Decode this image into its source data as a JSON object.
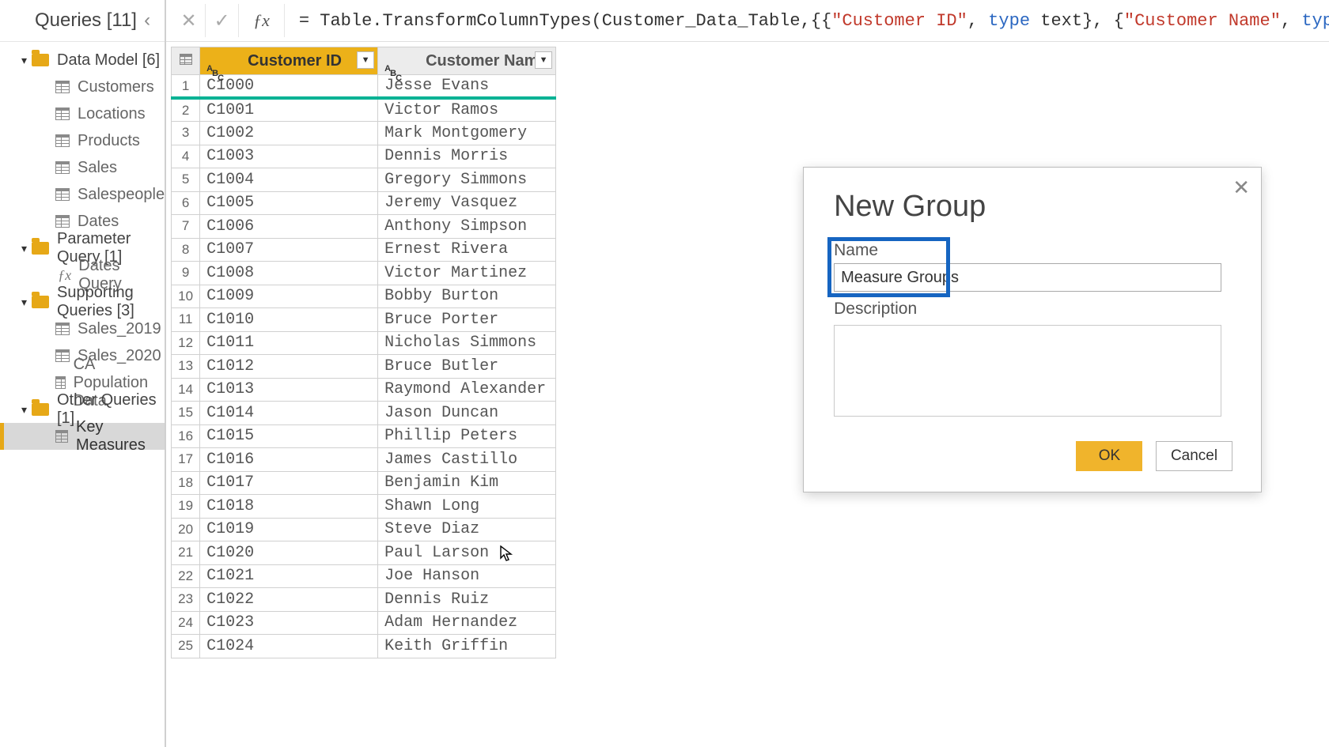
{
  "sidebar": {
    "title": "Queries [11]",
    "groups": [
      {
        "label": "Data Model [6]",
        "items": [
          "Customers",
          "Locations",
          "Products",
          "Sales",
          "Salespeople",
          "Dates"
        ],
        "icon": "table"
      },
      {
        "label": "Parameter Query [1]",
        "items": [
          "Dates Query"
        ],
        "icon": "fx"
      },
      {
        "label": "Supporting Queries [3]",
        "items": [
          "Sales_2019",
          "Sales_2020",
          "CA Population Data"
        ],
        "icon": "table"
      },
      {
        "label": "Other Queries [1]",
        "items": [
          "Key Measures"
        ],
        "icon": "table",
        "selected_index": 0
      }
    ]
  },
  "formula": {
    "text": "= Table.TransformColumnTypes(Customer_Data_Table,{{\"Customer ID\", type text}, {\"Customer Name\", type"
  },
  "grid": {
    "columns": [
      "Customer ID",
      "Customer Name"
    ],
    "selected_column_index": 0,
    "rows": [
      {
        "n": 1,
        "id": "C1000",
        "name": "Jesse Evans"
      },
      {
        "n": 2,
        "id": "C1001",
        "name": "Victor Ramos"
      },
      {
        "n": 3,
        "id": "C1002",
        "name": "Mark Montgomery"
      },
      {
        "n": 4,
        "id": "C1003",
        "name": "Dennis Morris"
      },
      {
        "n": 5,
        "id": "C1004",
        "name": "Gregory Simmons"
      },
      {
        "n": 6,
        "id": "C1005",
        "name": "Jeremy Vasquez"
      },
      {
        "n": 7,
        "id": "C1006",
        "name": "Anthony Simpson"
      },
      {
        "n": 8,
        "id": "C1007",
        "name": "Ernest Rivera"
      },
      {
        "n": 9,
        "id": "C1008",
        "name": "Victor Martinez"
      },
      {
        "n": 10,
        "id": "C1009",
        "name": "Bobby Burton"
      },
      {
        "n": 11,
        "id": "C1010",
        "name": "Bruce Porter"
      },
      {
        "n": 12,
        "id": "C1011",
        "name": "Nicholas Simmons"
      },
      {
        "n": 13,
        "id": "C1012",
        "name": "Bruce Butler"
      },
      {
        "n": 14,
        "id": "C1013",
        "name": "Raymond Alexander"
      },
      {
        "n": 15,
        "id": "C1014",
        "name": "Jason Duncan"
      },
      {
        "n": 16,
        "id": "C1015",
        "name": "Phillip Peters"
      },
      {
        "n": 17,
        "id": "C1016",
        "name": "James Castillo"
      },
      {
        "n": 18,
        "id": "C1017",
        "name": "Benjamin Kim"
      },
      {
        "n": 19,
        "id": "C1018",
        "name": "Shawn Long"
      },
      {
        "n": 20,
        "id": "C1019",
        "name": "Steve Diaz"
      },
      {
        "n": 21,
        "id": "C1020",
        "name": "Paul Larson"
      },
      {
        "n": 22,
        "id": "C1021",
        "name": "Joe Hanson"
      },
      {
        "n": 23,
        "id": "C1022",
        "name": "Dennis Ruiz"
      },
      {
        "n": 24,
        "id": "C1023",
        "name": "Adam Hernandez"
      },
      {
        "n": 25,
        "id": "C1024",
        "name": "Keith Griffin"
      }
    ]
  },
  "dialog": {
    "title": "New Group",
    "name_label": "Name",
    "name_value": "Measure Groups",
    "desc_label": "Description",
    "ok": "OK",
    "cancel": "Cancel"
  },
  "colors": {
    "folder": "#e6a817",
    "highlight": "#1665c1",
    "primary_button": "#f0b42c",
    "column_select": "#ecb119",
    "teal_underline": "#00b294"
  }
}
